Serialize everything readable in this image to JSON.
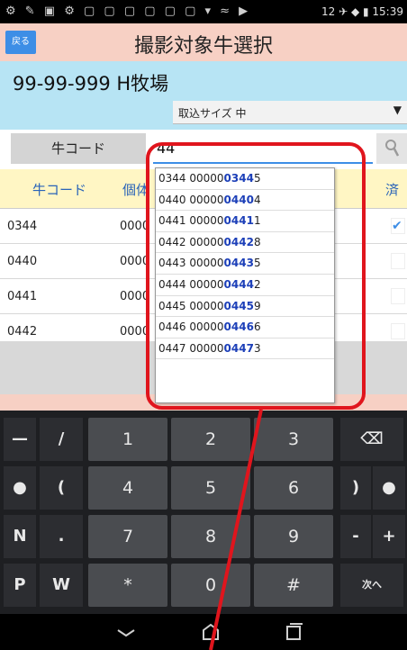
{
  "status_bar": {
    "left_icons": "⚙ ✎ ▣ ⚙ ▢ ▢ ▢ ▢ ▢ ▢ ▾ ≈ ▶",
    "right_text": "12 ✈ ◆ ▮ 15:39"
  },
  "header": {
    "back_label": "戻る",
    "title": "撮影対象牛選択"
  },
  "farm": {
    "name": "99-99-999 H牧場",
    "size_select": "取込サイズ 中"
  },
  "search": {
    "key_label": "牛コード",
    "value": "44"
  },
  "table": {
    "headers": {
      "code": "牛コード",
      "id": "個体",
      "done": "済"
    },
    "rows": [
      {
        "code": "0344",
        "id": "0000",
        "checked": "✔"
      },
      {
        "code": "0440",
        "id": "0000",
        "checked": ""
      },
      {
        "code": "0441",
        "id": "0000",
        "checked": ""
      },
      {
        "code": "0442",
        "id": "0000",
        "checked": ""
      }
    ]
  },
  "dropdown": {
    "items": [
      {
        "prefix": "0344 00000",
        "highlight": "0344",
        "suffix": "5"
      },
      {
        "prefix": "0440 00000",
        "highlight": "0440",
        "suffix": "4"
      },
      {
        "prefix": "0441 00000",
        "highlight": "0441",
        "suffix": "1"
      },
      {
        "prefix": "0442 00000",
        "highlight": "0442",
        "suffix": "8"
      },
      {
        "prefix": "0443 00000",
        "highlight": "0443",
        "suffix": "5"
      },
      {
        "prefix": "0444 00000",
        "highlight": "0444",
        "suffix": "2"
      },
      {
        "prefix": "0445 00000",
        "highlight": "0445",
        "suffix": "9"
      },
      {
        "prefix": "0446 00000",
        "highlight": "0446",
        "suffix": "6"
      },
      {
        "prefix": "0447 00000",
        "highlight": "0447",
        "suffix": "3"
      }
    ]
  },
  "keyboard": {
    "row1": [
      "—",
      "/",
      "1",
      "2",
      "3",
      "⌫"
    ],
    "row2": [
      "●",
      "(",
      "4",
      "5",
      "6",
      ")",
      "●"
    ],
    "row3": [
      "N",
      ".",
      "7",
      "8",
      "9",
      "-",
      "+"
    ],
    "row4": [
      "P",
      "W",
      "*",
      "0",
      "#",
      "次へ"
    ]
  },
  "colors": {
    "title_bg": "#f7d0c4",
    "farm_bg": "#b7e4f4",
    "header_bg": "#fff6c4",
    "accent_blue": "#3d8ee6",
    "annotation_red": "#e0151d"
  }
}
